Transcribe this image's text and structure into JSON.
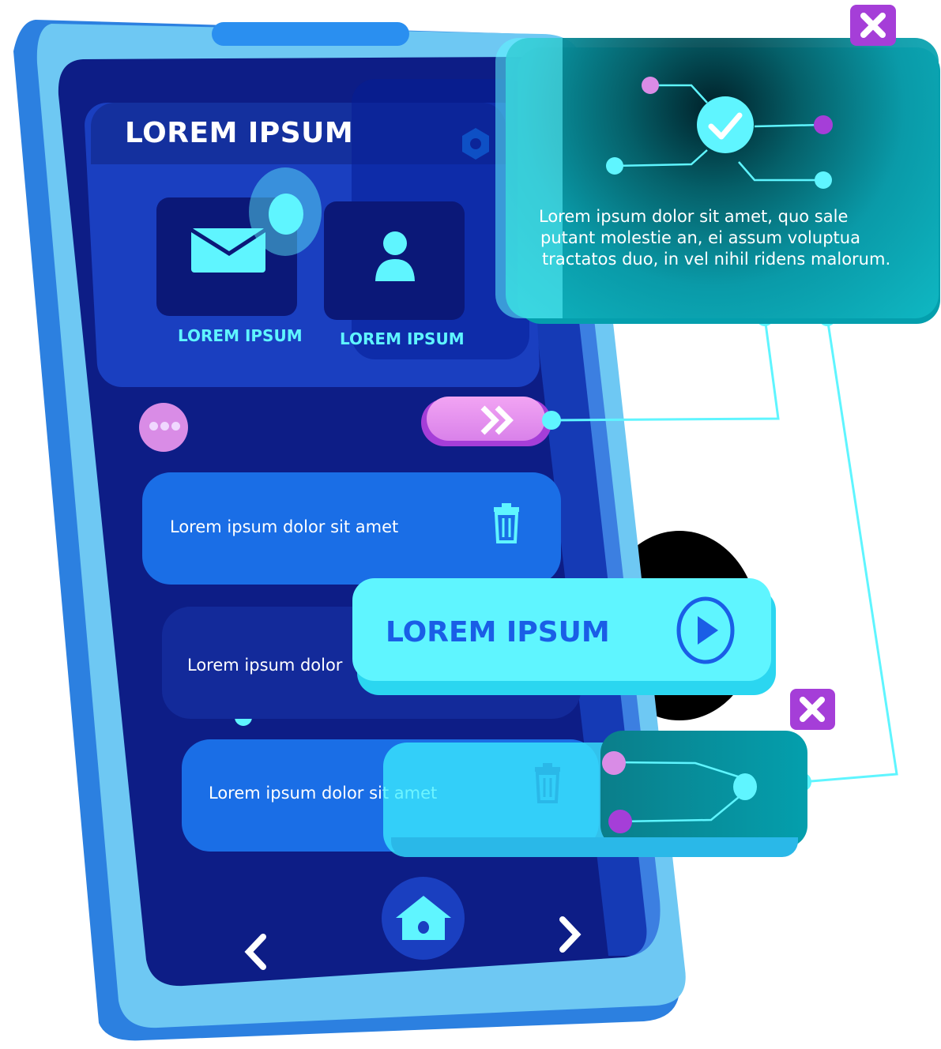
{
  "colors": {
    "phone_shell": "#6ec8f3",
    "screen": "#0d1d86",
    "card": "#1a52c9",
    "cyan": "#5ff5ff",
    "teal_panel": "#049fad",
    "pink": "#d98ce6",
    "purple": "#a53ed8"
  },
  "header": {
    "title": "LOREM IPSUM",
    "settings_icon": "hexagon-nut-icon"
  },
  "apps": [
    {
      "label": "LOREM IPSUM",
      "icon": "envelope-icon"
    },
    {
      "label": "LOREM IPSUM",
      "icon": "user-icon"
    }
  ],
  "controls": {
    "more_icon": "ellipsis-icon",
    "forward_icon": "double-chevron-right-icon"
  },
  "list": [
    {
      "text": "Lorem ipsum dolor sit amet",
      "icon": "trash-icon"
    },
    {
      "text": "Lorem ipsum dolor",
      "icon": ""
    },
    {
      "text": "Lorem ipsum dolor sit amet",
      "icon": "trash-icon"
    }
  ],
  "cta": {
    "label": "LOREM IPSUM",
    "icon": "play-icon"
  },
  "info_panel": {
    "line1": "Lorem ipsum dolor sit amet, quo sale",
    "line2": "putant molestie an, ei assum voluptua",
    "line3": "tractatos duo, in vel nihil ridens malorum.",
    "icon": "check-circle-icon"
  },
  "nav": {
    "back_icon": "chevron-left-icon",
    "home_icon": "home-icon",
    "forward_icon": "chevron-right-icon"
  },
  "close_icons": [
    "close-icon",
    "close-icon"
  ]
}
